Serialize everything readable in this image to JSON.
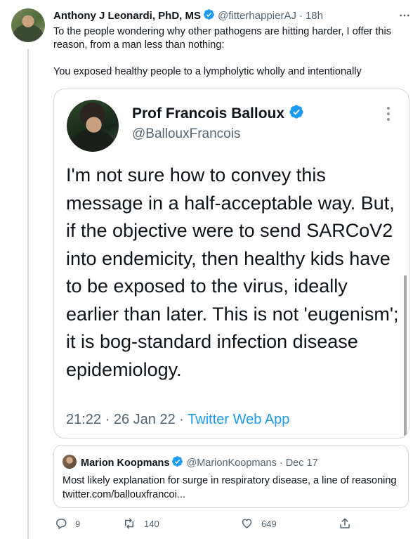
{
  "tweet": {
    "author_name": "Anthony J Leonardi, PhD, MS",
    "handle": "@fitterhappierAJ",
    "separator": "·",
    "time": "18h",
    "text_line1": "To the people wondering why other pathogens are hitting harder, I offer this reason, from a man less than nothing:",
    "text_line2": "You exposed healthy people to a lympholytic wholly and intentionally"
  },
  "media_screenshot": {
    "author_name": "Prof Francois Balloux",
    "handle": "@BallouxFrancois",
    "text": "I'm not sure how to convey this message in a half-acceptable way. But, if the objective were to send SARCoV2 into endemicity, then healthy kids have to be exposed to the virus, ideally earlier than later. This is not 'eugenism'; it is bog-standard infection disease epidemiology.",
    "time": "21:22",
    "date": "26 Jan 22",
    "separator": "·",
    "app": "Twitter Web App"
  },
  "quoted_tweet": {
    "author_name": "Marion Koopmans",
    "handle": "@MarionKoopmans",
    "separator": "·",
    "time": "Dec 17",
    "text": "Most likely explanation for surge in respiratory disease, a line of reasoning twitter.com/ballouxfrancoi..."
  },
  "actions": {
    "replies": "9",
    "retweets": "140",
    "likes": "649"
  },
  "icons": {
    "verified": "verified-badge-icon",
    "more": "more-dots-icon",
    "reply": "reply-icon",
    "retweet": "retweet-icon",
    "like": "heart-icon",
    "share": "share-icon"
  },
  "colors": {
    "accent": "#1d9bf0",
    "text": "#0f1419",
    "muted": "#536471",
    "border": "#cfd9de"
  }
}
